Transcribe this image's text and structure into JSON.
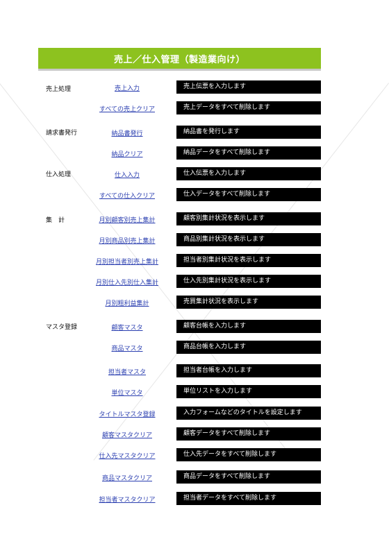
{
  "title": "売上／仕入管理（製造業向け）",
  "sections": {
    "sales": "売上処理",
    "invoice": "請求書発行",
    "purchase": "仕入処理",
    "summary": "集　計",
    "master": "マスタ登録"
  },
  "rows": [
    {
      "link": "売上入力",
      "desc": "売上伝票を入力します"
    },
    {
      "link": "すべての売上クリア",
      "desc": "売上データをすべて削除します"
    },
    {
      "link": "納品書発行",
      "desc": "納品書を発行します"
    },
    {
      "link": "納品クリア",
      "desc": "納品データをすべて削除します"
    },
    {
      "link": "仕入入力",
      "desc": "仕入伝票を入力します"
    },
    {
      "link": "すべての仕入クリア",
      "desc": "仕入データをすべて削除します"
    },
    {
      "link": "月別顧客別売上集計",
      "desc": "顧客別集計状況を表示します"
    },
    {
      "link": "月別商品別売上集計",
      "desc": "商品別集計状況を表示します"
    },
    {
      "link": "月別担当者別売上集計",
      "desc": "担当者別集計状況を表示します"
    },
    {
      "link": "月別仕入先別仕入集計",
      "desc": "仕入先別集計状況を表示します"
    },
    {
      "link": "月別粗利益集計",
      "desc": "売買集計状況を表示します"
    },
    {
      "link": "顧客マスタ",
      "desc": "顧客台帳を入力します"
    },
    {
      "link": "商品マスタ",
      "desc": "商品台帳を入力します"
    },
    {
      "link": "担当者マスタ",
      "desc": "担当者台帳を入力します"
    },
    {
      "link": "単位マスタ",
      "desc": "単位リストを入力します"
    },
    {
      "link": "タイトルマスタ登録",
      "desc": "入力フォームなどのタイトルを設定します"
    },
    {
      "link": "顧客マスタクリア",
      "desc": "顧客データをすべて削除します"
    },
    {
      "link": "仕入先マスタクリア",
      "desc": "仕入先データをすべて削除します"
    },
    {
      "link": "商品マスタクリア",
      "desc": "商品データをすべて削除します"
    },
    {
      "link": "担当者マスタクリア",
      "desc": "担当者データをすべて削除します"
    }
  ],
  "colors": {
    "title_bar": "#8dc21f",
    "link": "#2b3fb0",
    "desc_bg": "#000000"
  }
}
